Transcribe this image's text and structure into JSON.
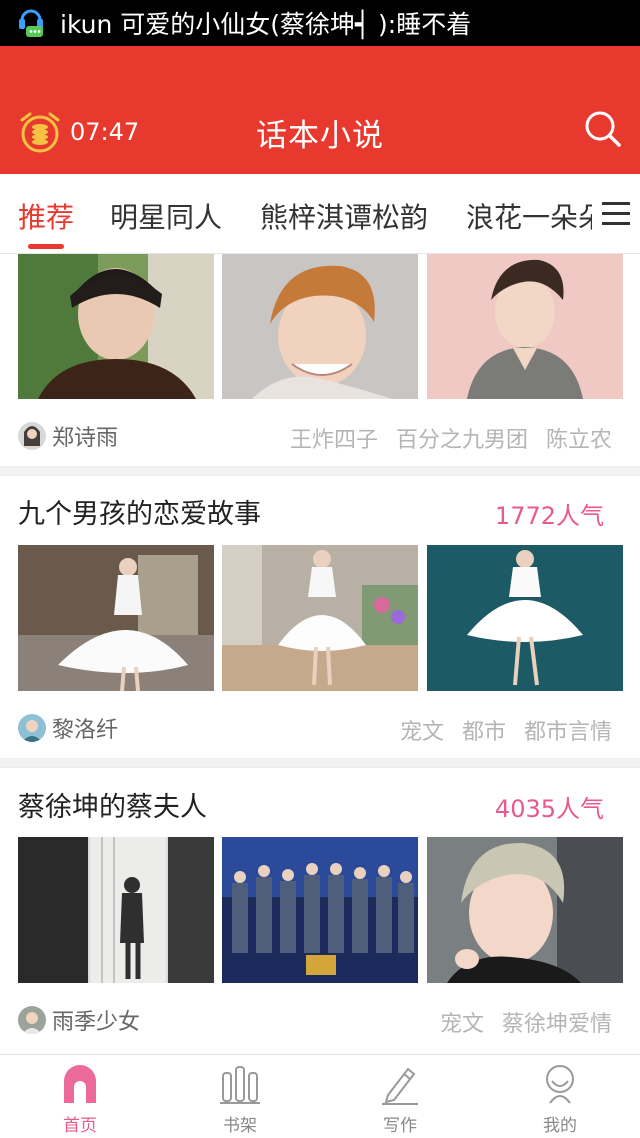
{
  "notification": {
    "text": "ikun 可爱的小仙女(蔡徐坤┥ ):睡不着",
    "icon": "chat-bubble-icon"
  },
  "header": {
    "time": "07:47",
    "title": "话本小说",
    "clock_icon": "alarm-clock-icon",
    "search_icon": "search-icon"
  },
  "tabs": [
    {
      "label": "推荐"
    },
    {
      "label": "明星同人"
    },
    {
      "label": "熊梓淇谭松韵"
    },
    {
      "label": "浪花一朵朵"
    }
  ],
  "tabs_menu_icon": "menu-icon",
  "cards": [
    {
      "title": "",
      "popularity": "",
      "author": "郑诗雨",
      "tags": [
        "王炸四子",
        "百分之九男团",
        "陈立农"
      ]
    },
    {
      "title": "九个男孩的恋爱故事",
      "popularity": "1772人气",
      "author": "黎洛纤",
      "tags": [
        "宠文",
        "都市",
        "都市言情"
      ]
    },
    {
      "title": "蔡徐坤的蔡夫人",
      "popularity": "4035人气",
      "author": "雨季少女",
      "tags": [
        "宠文",
        "蔡徐坤爱情"
      ]
    }
  ],
  "nav": [
    {
      "label": "首页",
      "icon": "home-icon"
    },
    {
      "label": "书架",
      "icon": "bookshelf-icon"
    },
    {
      "label": "写作",
      "icon": "pencil-icon"
    },
    {
      "label": "我的",
      "icon": "profile-icon"
    }
  ],
  "colors": {
    "brand": "#e8392e",
    "popularity": "#e75a8e",
    "active_nav": "#e75a8e"
  }
}
